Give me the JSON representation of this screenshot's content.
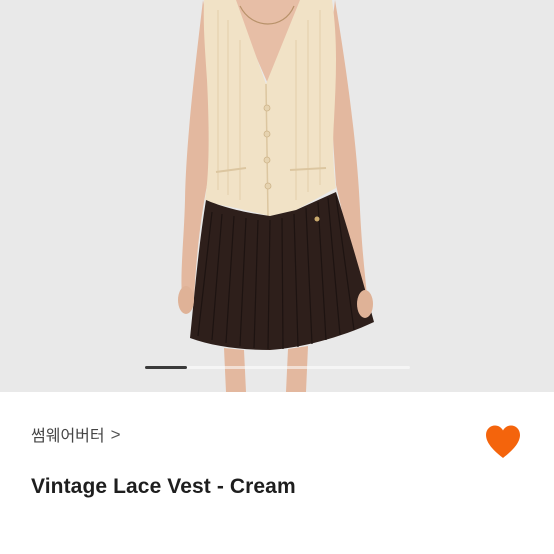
{
  "product": {
    "title": "Vintage Lace Vest - Cream",
    "image_alt": "Model wearing a cream vintage lace vest with a dark brown pleated skirt"
  },
  "seller": {
    "name": "썸웨어버터",
    "chevron_icon": "chevron-right-icon",
    "chevron_glyph": ">"
  },
  "like": {
    "icon": "heart-icon",
    "liked": true,
    "color": "#f4640c"
  },
  "carousel": {
    "current_index": 1,
    "progress_fraction": 0.16
  },
  "colors": {
    "vest": "#f1e2c6",
    "skirt": "#2e1f1b",
    "background": "#e9e9e9"
  }
}
